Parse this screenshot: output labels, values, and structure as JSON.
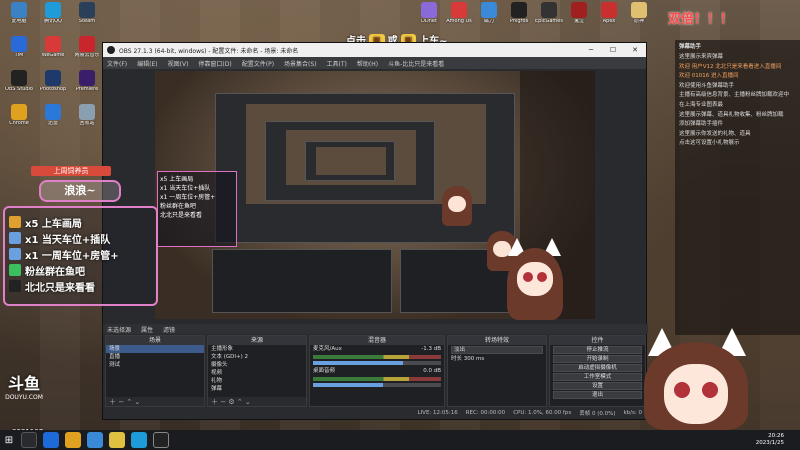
{
  "desktop": {
    "icons_left": [
      {
        "label": "此电脑",
        "color": "#3b82c4"
      },
      {
        "label": "腾讯QQ",
        "color": "#1e9bd8"
      },
      {
        "label": "Steam",
        "color": "#2a3f5a"
      },
      {
        "label": "TIM",
        "color": "#2a6ad8"
      },
      {
        "label": "WeGame",
        "color": "#d83a3a"
      },
      {
        "label": "网易云音乐",
        "color": "#c8262c"
      },
      {
        "label": "OBS Studio",
        "color": "#222222"
      },
      {
        "label": "Photoshop",
        "color": "#1e3a6a"
      },
      {
        "label": "Premiere",
        "color": "#3a1e6a"
      },
      {
        "label": "Chrome",
        "color": "#e0a020"
      },
      {
        "label": "迅雷",
        "color": "#2a78d8"
      },
      {
        "label": "回收站",
        "color": "#8aa0b0"
      }
    ],
    "icons_top": [
      {
        "label": "DDnet",
        "color": "#8a6ad8"
      },
      {
        "label": "Among Us",
        "color": "#d83a3a"
      },
      {
        "label": "磁力",
        "color": "#3a8ad8"
      },
      {
        "label": "Phigros",
        "color": "#222222"
      },
      {
        "label": "EpicGames",
        "color": "#333333"
      },
      {
        "label": "鬼泣",
        "color": "#a02020"
      },
      {
        "label": "Apex",
        "color": "#c83030"
      },
      {
        "label": "原神",
        "color": "#e0c070"
      }
    ],
    "top_right_text": "双倍！！！",
    "watermark": "DOUYU.COM",
    "watermark_big": "斗鱼",
    "room_id": "8381107"
  },
  "banner": {
    "left": "点击",
    "mid": "或",
    "right": "上车~"
  },
  "obs": {
    "title": "OBS 27.1.3 (64-bit, windows) - 配置文件: 未命名 - 场景: 未命名",
    "menu": [
      "文件(F)",
      "编辑(E)",
      "视图(V)",
      "停靠窗口(D)",
      "配置文件(P)",
      "场景集合(S)",
      "工具(T)",
      "帮助(H)",
      "斗鱼-比比只是来看看"
    ],
    "dock_header": [
      "未选择源",
      "属性",
      "滤镜"
    ],
    "scenes": {
      "header": "场景",
      "items": [
        "场景",
        "直播",
        "测试"
      ]
    },
    "sources": {
      "header": "来源",
      "items": [
        "主播形象",
        "文本 (GDI+) 2",
        "摄像头",
        "视频",
        "礼物",
        "弹幕"
      ]
    },
    "mixer": {
      "header": "混音器",
      "channels": [
        {
          "name": "麦克风/Aux",
          "db": "-1.3 dB",
          "level": 0.7
        },
        {
          "name": "桌面音频",
          "db": "0.0 dB",
          "level": 0.55
        }
      ]
    },
    "transitions": {
      "header": "转场特效",
      "type": "淡出",
      "duration_label": "时长",
      "duration": "300 ms"
    },
    "controls": {
      "header": "控件",
      "buttons": [
        "停止推流",
        "开始录制",
        "启动虚拟摄像机",
        "工作室模式",
        "设置",
        "退出"
      ]
    },
    "status": {
      "live": "LIVE: 12:05:16",
      "rec": "REC: 00:00:00",
      "cpu": "CPU: 1.0%, 60.00 fps",
      "frames": "丢帧 0 (0.0%)",
      "kbps": "kb/s: 0"
    }
  },
  "left_overlay": {
    "title": "上周饲养员",
    "badge": "浪浪~",
    "items": [
      {
        "text": "x5 上车画局",
        "color": "#e0a030"
      },
      {
        "text": "x1 当天车位+插队",
        "color": "#6aa0e0"
      },
      {
        "text": "x1 一周车位+房管+",
        "color": "#6aa0e0"
      },
      {
        "text": "粉丝群在鱼吧",
        "color": "#3ac060"
      },
      {
        "text": "北北只是来看看",
        "color": "#222222"
      }
    ]
  },
  "chat": {
    "header": "弹幕助手",
    "lines": [
      {
        "text": "这里展示来宾弹幕",
        "hl": false
      },
      {
        "text": "欢迎 用户V12 北北只是来看看进入直播间",
        "hl": true
      },
      {
        "text": "欢迎 01016 进入直播间",
        "hl": true
      },
      {
        "text": "欢迎使用斗鱼弹幕助手",
        "hl": false
      },
      {
        "text": "主播有高级信息背景、主播粉丝牌加载欢迎中",
        "hl": false
      },
      {
        "text": "在上海专业图表最",
        "hl": false
      },
      {
        "text": "这里展示弹幕、道具礼物收集、粉丝牌加载",
        "hl": false
      },
      {
        "text": "添加弹幕助手插件",
        "hl": false
      },
      {
        "text": "这里展示你发送的礼物、道具",
        "hl": false
      },
      {
        "text": "点击这可设置小礼物展示",
        "hl": false
      }
    ]
  },
  "taskbar": {
    "time": "20:26",
    "date": "2023/1/25"
  }
}
